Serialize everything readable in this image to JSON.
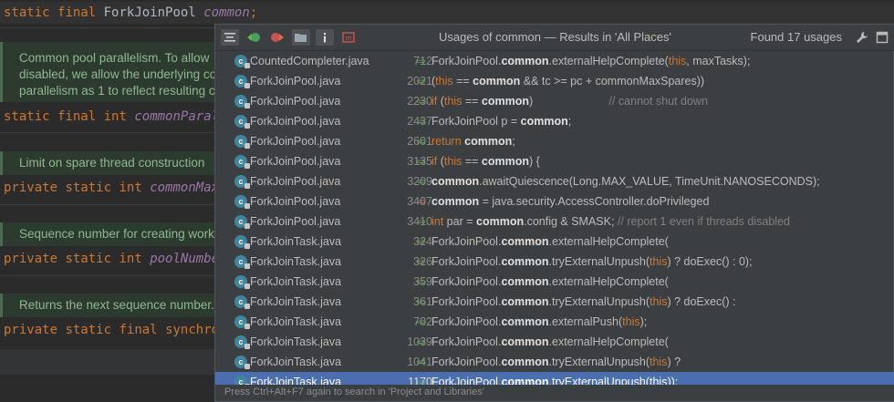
{
  "editor": {
    "line1": {
      "kw1": "static",
      "kw2": "final",
      "type": "ForkJoinPool",
      "name": "common",
      "semi": ";"
    },
    "doc1": [
      "Common pool parallelism. To allow",
      "disabled, we allow the underlying co",
      "parallelism as 1 to reflect resulting c"
    ],
    "line2": {
      "kw1": "static",
      "kw2": "final",
      "kw3": "int",
      "name": "commonParall"
    },
    "doc2": "Limit on spare thread construction",
    "line3": {
      "kw1": "private",
      "kw2": "static",
      "kw3": "int",
      "name": "commonMaxS"
    },
    "doc3": "Sequence number for creating work",
    "line4": {
      "kw1": "private",
      "kw2": "static",
      "kw3": "int",
      "name": "poolNumber"
    },
    "doc4": "Returns the next sequence number.",
    "line5": {
      "kw1": "private",
      "kw2": "static",
      "kw3": "final",
      "kw4": "synchron"
    }
  },
  "popup": {
    "title": "Usages of common — Results in 'All Places'",
    "found": "Found 17 usages",
    "toolbar": {
      "icons": [
        "align-icon",
        "navigate-back-icon",
        "navigate-forward-icon",
        "folder-icon",
        "info-icon",
        "filter-icon"
      ]
    },
    "footer": "Press Ctrl+Alt+F7 again to search in 'Project and Libraries'",
    "rows": [
      {
        "file": "CountedCompleter.java",
        "line": "712",
        "arrow": "read",
        "code": [
          [
            "",
            "ForkJoinPool."
          ],
          [
            "b",
            "common"
          ],
          [
            "",
            ".externalHelpComplete("
          ],
          [
            "k",
            "this"
          ],
          [
            "",
            ", maxTasks);"
          ]
        ]
      },
      {
        "file": "ForkJoinPool.java",
        "line": "2021",
        "arrow": "read",
        "code": [
          [
            "",
            "("
          ],
          [
            "k",
            "this"
          ],
          [
            "",
            " == "
          ],
          [
            "b",
            "common"
          ],
          [
            "",
            " && tc >= pc + commonMaxSpares))"
          ]
        ]
      },
      {
        "file": "ForkJoinPool.java",
        "line": "2230",
        "arrow": "read",
        "code": [
          [
            "k",
            "if"
          ],
          [
            "",
            " ("
          ],
          [
            "k",
            "this"
          ],
          [
            "",
            " == "
          ],
          [
            "b",
            "common"
          ],
          [
            "",
            ")"
          ],
          [
            "c",
            "                        // cannot shut down"
          ]
        ]
      },
      {
        "file": "ForkJoinPool.java",
        "line": "2437",
        "arrow": "read",
        "code": [
          [
            "",
            "ForkJoinPool p = "
          ],
          [
            "b",
            "common"
          ],
          [
            "",
            ";"
          ]
        ]
      },
      {
        "file": "ForkJoinPool.java",
        "line": "2601",
        "arrow": "read",
        "code": [
          [
            "k",
            "return"
          ],
          [
            "",
            " "
          ],
          [
            "b",
            "common"
          ],
          [
            "",
            ";"
          ]
        ]
      },
      {
        "file": "ForkJoinPool.java",
        "line": "3135",
        "arrow": "read",
        "code": [
          [
            "k",
            "if"
          ],
          [
            "",
            " ("
          ],
          [
            "k",
            "this"
          ],
          [
            "",
            " == "
          ],
          [
            "b",
            "common"
          ],
          [
            "",
            ") {"
          ]
        ]
      },
      {
        "file": "ForkJoinPool.java",
        "line": "3209",
        "arrow": "read",
        "code": [
          [
            "b",
            "common"
          ],
          [
            "",
            ".awaitQuiescence(Long.MAX_VALUE, TimeUnit.NANOSECONDS);"
          ]
        ]
      },
      {
        "file": "ForkJoinPool.java",
        "line": "3407",
        "arrow": "write",
        "code": [
          [
            "b",
            "common"
          ],
          [
            "",
            " = java.security.AccessController.doPrivileged"
          ]
        ]
      },
      {
        "file": "ForkJoinPool.java",
        "line": "3410",
        "arrow": "read",
        "code": [
          [
            "k",
            "int"
          ],
          [
            "",
            " par = "
          ],
          [
            "b",
            "common"
          ],
          [
            "",
            ".config & SMASK; "
          ],
          [
            "c",
            "// report 1 even if threads disabled"
          ]
        ]
      },
      {
        "file": "ForkJoinTask.java",
        "line": "324",
        "arrow": "read",
        "code": [
          [
            "",
            "ForkJoinPool."
          ],
          [
            "b",
            "common"
          ],
          [
            "",
            ".externalHelpComplete("
          ]
        ]
      },
      {
        "file": "ForkJoinTask.java",
        "line": "326",
        "arrow": "read",
        "code": [
          [
            "",
            "ForkJoinPool."
          ],
          [
            "b",
            "common"
          ],
          [
            "",
            ".tryExternalUnpush("
          ],
          [
            "k",
            "this"
          ],
          [
            "",
            ") ? doExec() : 0);"
          ]
        ]
      },
      {
        "file": "ForkJoinTask.java",
        "line": "359",
        "arrow": "read",
        "code": [
          [
            "",
            "ForkJoinPool."
          ],
          [
            "b",
            "common"
          ],
          [
            "",
            ".externalHelpComplete("
          ]
        ]
      },
      {
        "file": "ForkJoinTask.java",
        "line": "361",
        "arrow": "read",
        "code": [
          [
            "",
            "ForkJoinPool."
          ],
          [
            "b",
            "common"
          ],
          [
            "",
            ".tryExternalUnpush("
          ],
          [
            "k",
            "this"
          ],
          [
            "",
            ") ? doExec() :"
          ]
        ]
      },
      {
        "file": "ForkJoinTask.java",
        "line": "702",
        "arrow": "read",
        "code": [
          [
            "",
            "ForkJoinPool."
          ],
          [
            "b",
            "common"
          ],
          [
            "",
            ".externalPush("
          ],
          [
            "k",
            "this"
          ],
          [
            "",
            ");"
          ]
        ]
      },
      {
        "file": "ForkJoinTask.java",
        "line": "1039",
        "arrow": "read",
        "code": [
          [
            "",
            "ForkJoinPool."
          ],
          [
            "b",
            "common"
          ],
          [
            "",
            ".externalHelpComplete("
          ]
        ]
      },
      {
        "file": "ForkJoinTask.java",
        "line": "1041",
        "arrow": "read",
        "code": [
          [
            "",
            "ForkJoinPool."
          ],
          [
            "b",
            "common"
          ],
          [
            "",
            ".tryExternalUnpush("
          ],
          [
            "k",
            "this"
          ],
          [
            "",
            ") ?"
          ]
        ]
      },
      {
        "file": "ForkJoinTask.java",
        "line": "1170",
        "arrow": "read",
        "selected": true,
        "code": [
          [
            "",
            "ForkJoinPool."
          ],
          [
            "b",
            "common"
          ],
          [
            "",
            ".tryExternalUnpush(this));"
          ]
        ]
      }
    ]
  }
}
